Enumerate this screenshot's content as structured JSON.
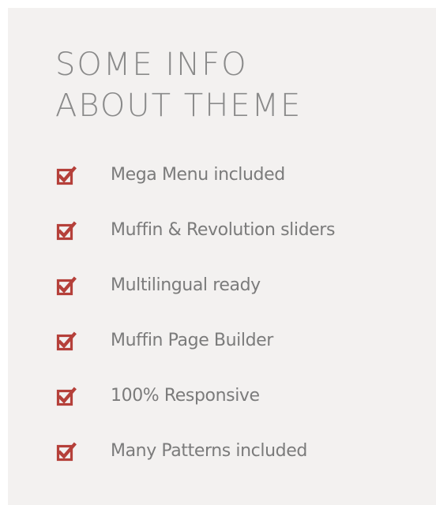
{
  "colors": {
    "panel_background": "#f3f1f0",
    "heading_text": "#8a8a8a",
    "item_text": "#7b7b7b",
    "accent": "#b5403a"
  },
  "theme_info": {
    "title_line_1": "SOME INFO",
    "title_line_2": "ABOUT THEME",
    "item_icon": "checkbox-checked-icon",
    "items": [
      {
        "label": "Mega Menu included"
      },
      {
        "label": "Muffin & Revolution sliders"
      },
      {
        "label": "Multilingual ready"
      },
      {
        "label": "Muffin Page Builder"
      },
      {
        "label": "100% Responsive"
      },
      {
        "label": "Many Patterns included"
      }
    ]
  }
}
